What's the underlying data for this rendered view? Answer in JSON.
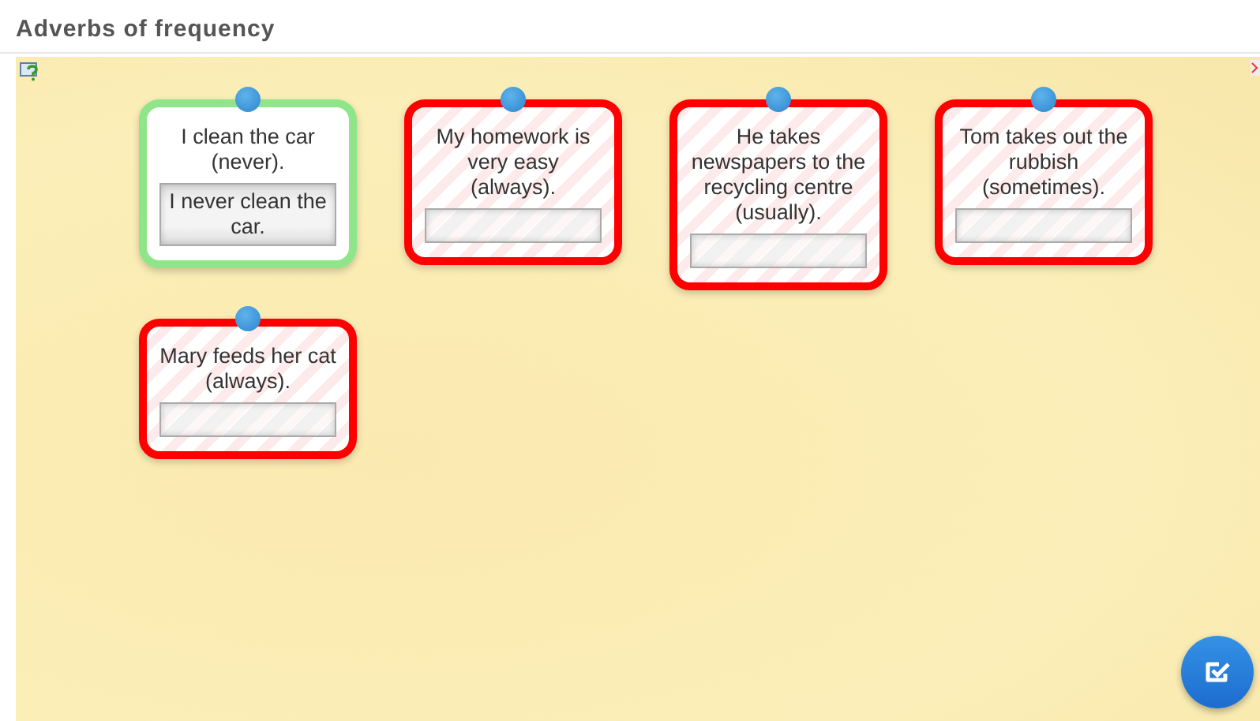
{
  "title": "Adverbs of frequency",
  "cards": [
    {
      "prompt": "I clean the car (never).",
      "answer": "I never clean the car.",
      "correct": true
    },
    {
      "prompt": "My homework is very easy (always).",
      "correct": false
    },
    {
      "prompt": "He takes newspapers to the recycling centre (usually).",
      "correct": false
    },
    {
      "prompt": "Tom takes out the rubbish (sometimes).",
      "correct": false
    },
    {
      "prompt": "Mary feeds her cat (always).",
      "correct": false
    }
  ]
}
